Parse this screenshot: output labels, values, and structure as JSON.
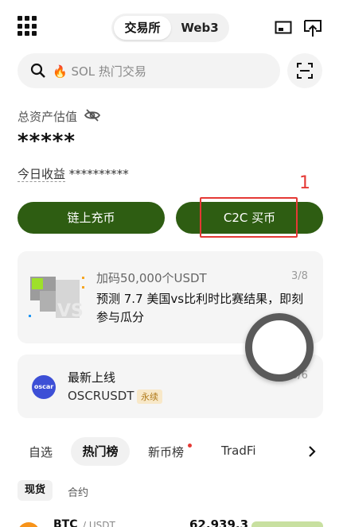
{
  "topbar": {
    "tabs": [
      "交易所",
      "Web3"
    ]
  },
  "search": {
    "placeholder": "🔥 SOL 热门交易"
  },
  "assets": {
    "label": "总资产估值",
    "value": "*****",
    "today_label": "今日收益",
    "today_value": "**********"
  },
  "annotation": "1",
  "buttons": {
    "onchain_deposit": "链上充币",
    "c2c_buy": "C2C 买币"
  },
  "promo": {
    "tag": "加码50,000个USDT",
    "page": "3/8",
    "description": "预测 7.7 美国vs比利时比赛结果，即刻参与瓜分"
  },
  "new_listing": {
    "title": "最新上线",
    "symbol": "OSCRUSDT",
    "badge": "永续",
    "page": "3/6",
    "logo_text": "oscar"
  },
  "tabs": [
    "自选",
    "热门榜",
    "新币榜",
    "TradFi"
  ],
  "subtabs": [
    "现货",
    "合约"
  ],
  "row": {
    "symbol": "BTC",
    "quote": "/ USDT",
    "price": "62,939.3"
  },
  "colors": {
    "accent": "#2e5d12",
    "annotation": "#e53935"
  }
}
